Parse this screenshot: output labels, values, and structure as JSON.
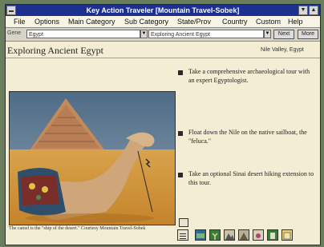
{
  "window": {
    "title": "Key Action Traveler  [Mountain Travel-Sobek]"
  },
  "menu": [
    "File",
    "Options",
    "Main Category",
    "Sub Category",
    "State/Prov",
    "Country",
    "Custom",
    "Help"
  ],
  "nav": {
    "label": "Gene",
    "field1": "Egypt",
    "field2": "Exploring Ancient Egypt",
    "next_label": "Next",
    "more_label": "More"
  },
  "page": {
    "title": "Exploring Ancient Egypt",
    "location": "Nile Valley, Egypt"
  },
  "photo": {
    "caption": "The camel is the \"ship of the desert.\" Courtesy Mountain Travel-Sobek"
  },
  "bullets": [
    "Take a comprehensive archaeological tour with an expert Egyptologist.",
    "Float down the Nile on the native sailboat, the \"feluca.\"",
    "Take an optional Sinai desert hiking extension to this tour."
  ],
  "toolbar_icons": [
    "list-icon",
    "money-icon",
    "plant-icon",
    "mountain-icon",
    "mountain2-icon",
    "flower-icon",
    "document-icon",
    "note-icon"
  ]
}
